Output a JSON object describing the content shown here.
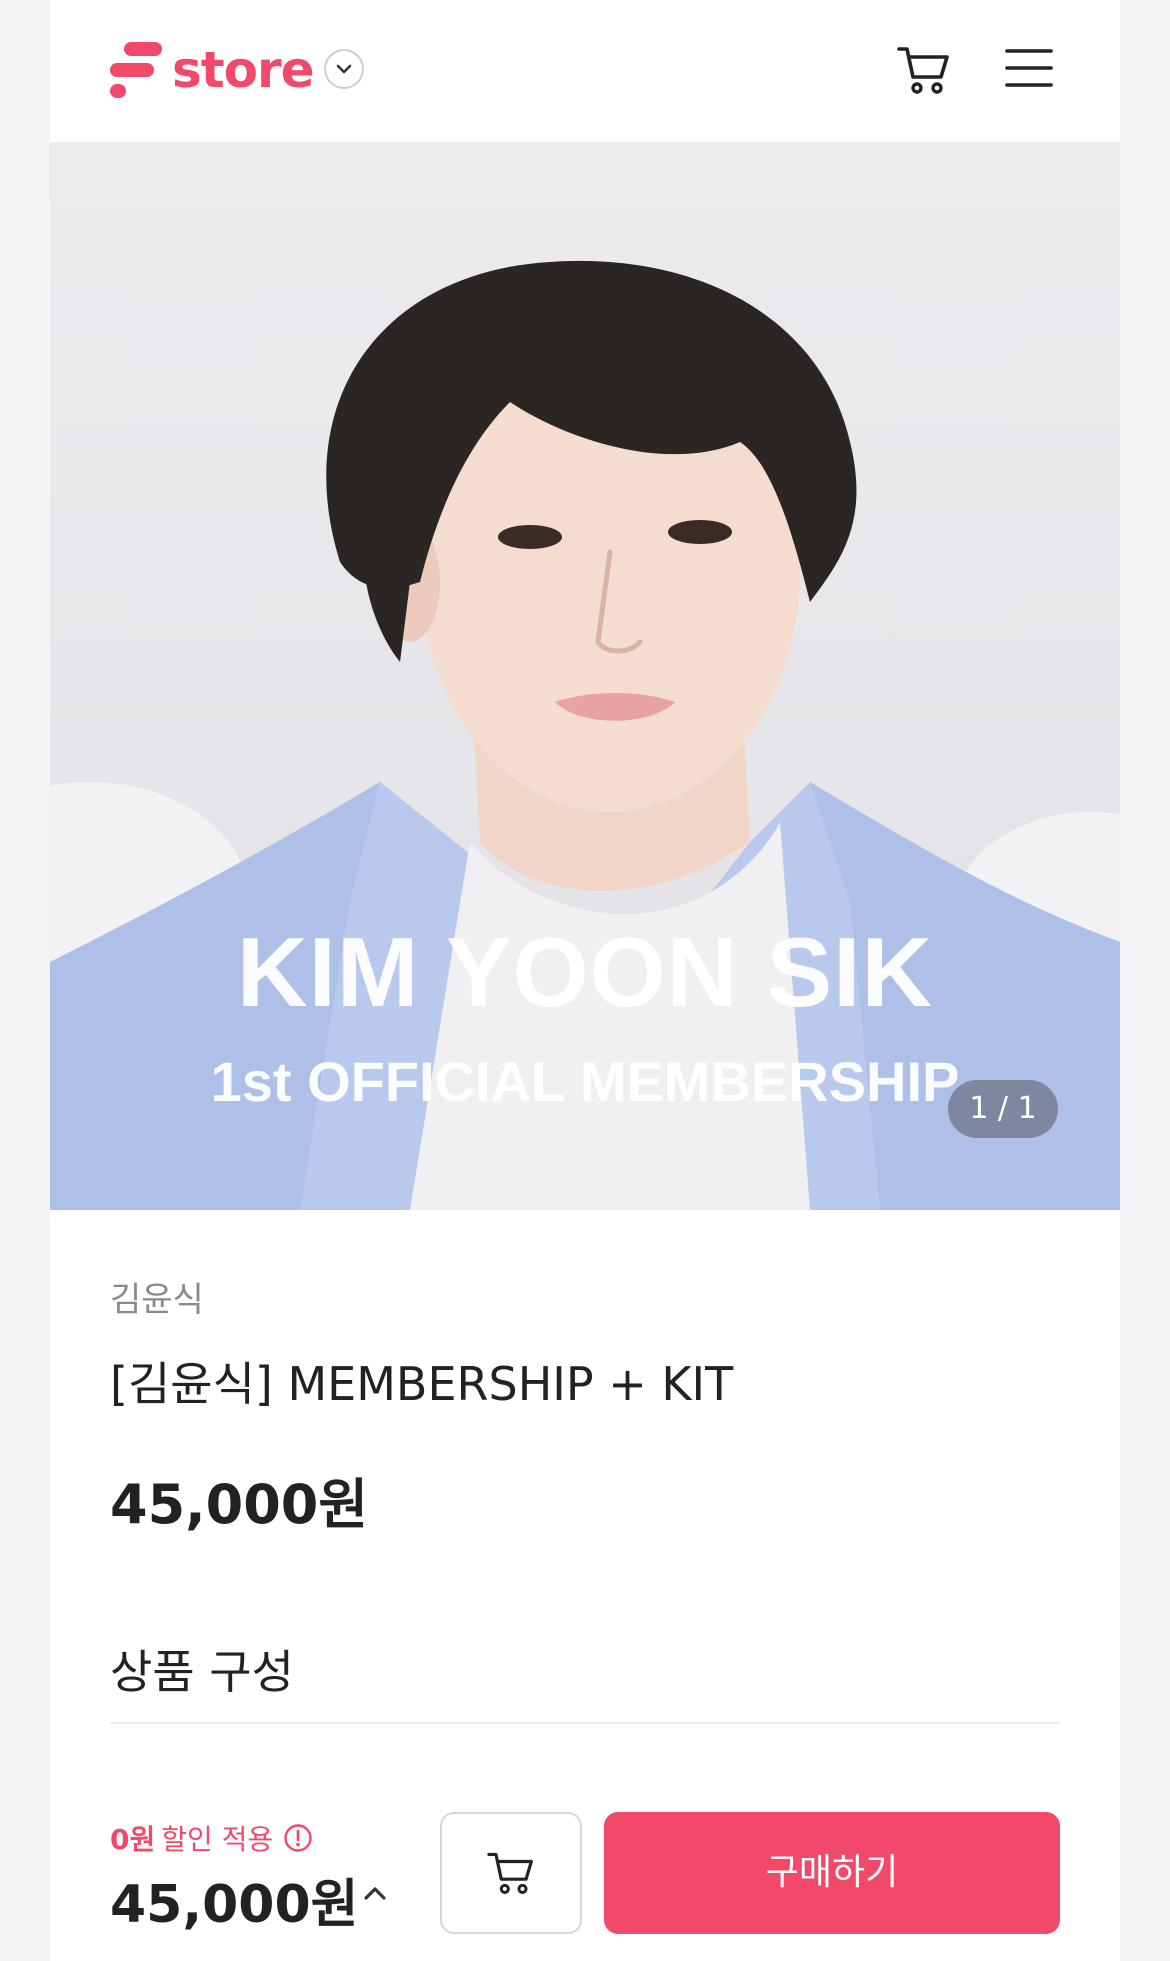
{
  "header": {
    "logo_text": "store",
    "logo_icon": "store-logo-mark",
    "dropdown_icon": "chevron-down-icon",
    "cart_icon": "cart-icon",
    "menu_icon": "hamburger-menu-icon"
  },
  "hero": {
    "overlay_title": "KIM YOON SIK",
    "overlay_subtitle": "1st OFFICIAL MEMBERSHIP",
    "counter": "1 / 1"
  },
  "product": {
    "artist": "김윤식",
    "title": "[김윤식] MEMBERSHIP + KIT",
    "price": "45,000원",
    "section_title": "상품 구성"
  },
  "purchase_bar": {
    "discount_amount": "0원",
    "discount_label": "할인 적용",
    "info_icon": "info-circle-icon",
    "total_price": "45,000원",
    "expand_icon": "chevron-up-icon",
    "cart_button_icon": "cart-icon",
    "buy_label": "구매하기"
  },
  "colors": {
    "brand": "#f2496a",
    "text": "#222222",
    "muted": "#8a8a8e"
  }
}
